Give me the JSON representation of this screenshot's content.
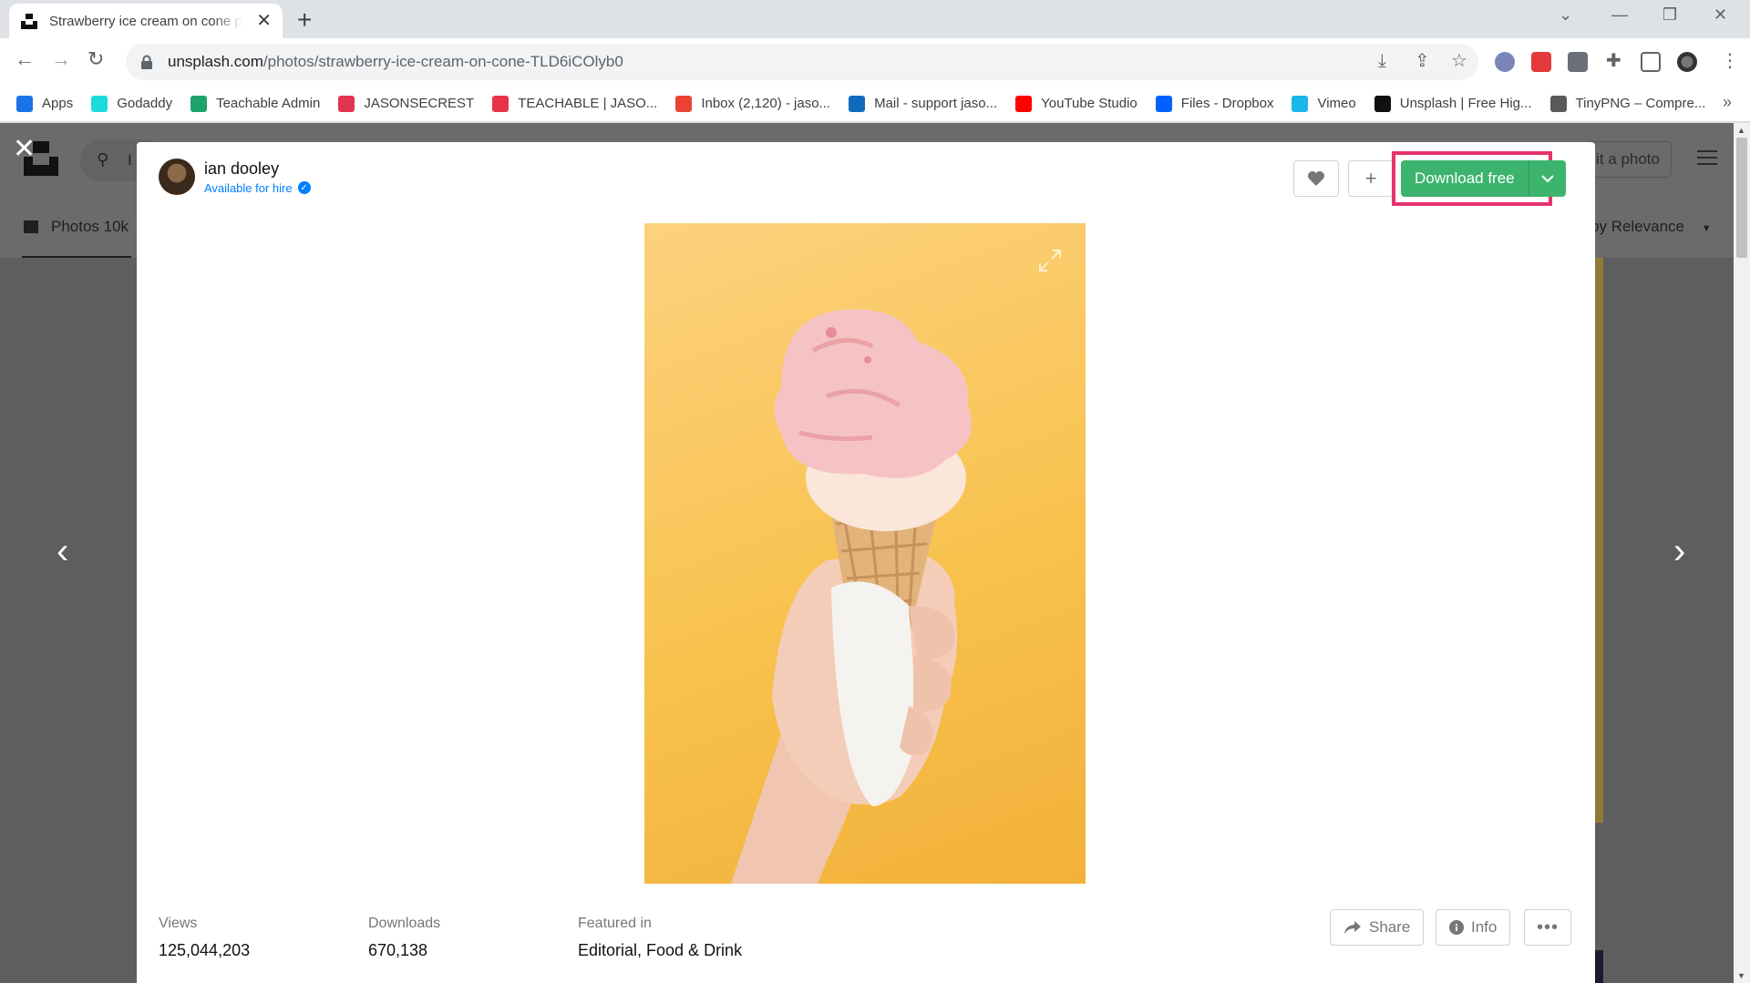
{
  "browser": {
    "tab_title": "Strawberry ice cream on cone photo – Free Food Image on Unsplash",
    "url_host": "unsplash.com",
    "url_path": "/photos/strawberry-ice-cream-on-cone-TLD6iCOlyb0"
  },
  "bookmarks": [
    {
      "label": "Apps",
      "icon": "apps-grid-icon",
      "color": "#1a73e8"
    },
    {
      "label": "Godaddy",
      "icon": "godaddy-icon",
      "color": "#1bdbdb"
    },
    {
      "label": "Teachable Admin",
      "icon": "teachable-icon",
      "color": "#1ca36b"
    },
    {
      "label": "JASONSECREST",
      "icon": "jasonsecrest-icon",
      "color": "#e2354f"
    },
    {
      "label": "TEACHABLE | JASO...",
      "icon": "teachable-download-icon",
      "color": "#e8334a"
    },
    {
      "label": "Inbox (2,120) - jaso...",
      "icon": "gmail-icon",
      "color": "#ea4335"
    },
    {
      "label": "Mail - support jaso...",
      "icon": "outlook-icon",
      "color": "#0f6cbd"
    },
    {
      "label": "YouTube Studio",
      "icon": "youtube-icon",
      "color": "#ff0000"
    },
    {
      "label": "Files - Dropbox",
      "icon": "dropbox-icon",
      "color": "#0061fe"
    },
    {
      "label": "Vimeo",
      "icon": "vimeo-icon",
      "color": "#1ab7ea"
    },
    {
      "label": "Unsplash | Free Hig...",
      "icon": "unsplash-icon",
      "color": "#111111"
    },
    {
      "label": "TinyPNG – Compre...",
      "icon": "tinypng-icon",
      "color": "#5a5a5a"
    }
  ],
  "background_page": {
    "search_placeholder_fragment": "I",
    "tab_photos": "Photos 10k",
    "submit_fragment": "it a photo",
    "sort_fragment": "by Relevance"
  },
  "modal": {
    "author_name": "ian dooley",
    "author_hire": "Available for hire",
    "download_label": "Download free",
    "stats": [
      {
        "label": "Views",
        "value": "125,044,203"
      },
      {
        "label": "Downloads",
        "value": "670,138"
      },
      {
        "label": "Featured in",
        "value": "Editorial, Food & Drink"
      }
    ],
    "share_label": "Share",
    "info_label": "Info"
  },
  "colors": {
    "download_green": "#3cb46e",
    "highlight_pink": "#e8336b",
    "hire_blue": "#007fff"
  }
}
